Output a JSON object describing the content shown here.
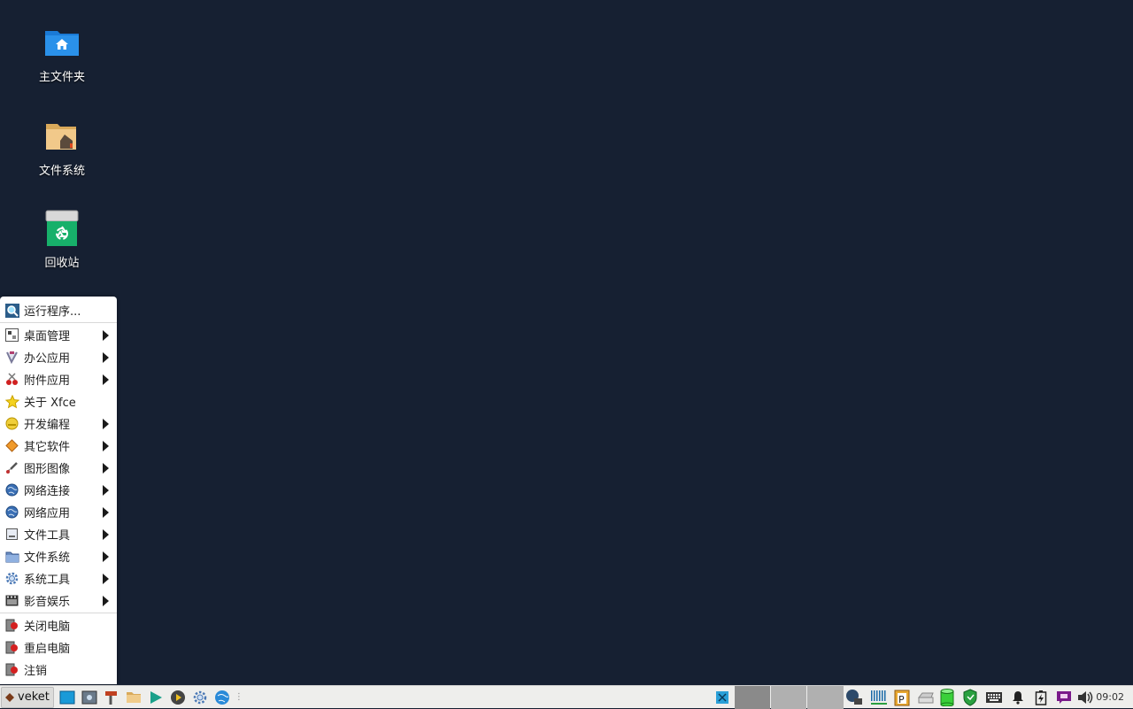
{
  "desktop": {
    "icons": [
      {
        "label": "主文件夹",
        "icon": "home-folder-icon"
      },
      {
        "label": "文件系统",
        "icon": "filesystem-folder-icon"
      },
      {
        "label": "回收站",
        "icon": "trash-icon"
      }
    ]
  },
  "menu": {
    "items": [
      {
        "label": "运行程序...",
        "icon": "search-icon",
        "submenu": false
      },
      {
        "label": "桌面管理",
        "icon": "desktop-settings-icon",
        "submenu": true
      },
      {
        "label": "办公应用",
        "icon": "office-icon",
        "submenu": true
      },
      {
        "label": "附件应用",
        "icon": "accessories-icon",
        "submenu": true
      },
      {
        "label": "关于 Xfce",
        "icon": "star-icon",
        "submenu": false
      },
      {
        "label": "开发编程",
        "icon": "development-icon",
        "submenu": true
      },
      {
        "label": "其它软件",
        "icon": "other-icon",
        "submenu": true
      },
      {
        "label": "图形图像",
        "icon": "graphics-icon",
        "submenu": true
      },
      {
        "label": "网络连接",
        "icon": "network-globe-icon",
        "submenu": true
      },
      {
        "label": "网络应用",
        "icon": "internet-globe-icon",
        "submenu": true
      },
      {
        "label": "文件工具",
        "icon": "file-tools-icon",
        "submenu": true
      },
      {
        "label": "文件系统",
        "icon": "folder-icon",
        "submenu": true
      },
      {
        "label": "系统工具",
        "icon": "gear-icon",
        "submenu": true
      },
      {
        "label": "影音娱乐",
        "icon": "multimedia-icon",
        "submenu": true
      },
      {
        "label": "关闭电脑",
        "icon": "shutdown-icon",
        "submenu": false
      },
      {
        "label": "重启电脑",
        "icon": "reboot-icon",
        "submenu": false
      },
      {
        "label": "注销",
        "icon": "logout-icon",
        "submenu": false
      }
    ]
  },
  "taskbar": {
    "start_label": "veket",
    "launchers": [
      "show-desktop-icon",
      "screenshot-icon",
      "paint-roller-icon",
      "file-manager-icon",
      "media-player-icon",
      "music-player-icon",
      "settings-gear-icon",
      "browser-icon"
    ],
    "tray": [
      "network-icon",
      "signal-meter-icon",
      "clipboard-icon",
      "printer-icon",
      "database-icon",
      "shield-icon",
      "keyboard-icon",
      "bell-icon",
      "battery-icon",
      "chat-icon",
      "volume-icon"
    ],
    "clock": "09:02"
  },
  "colors": {
    "desktop_bg": "#162032",
    "menu_bg": "#ffffff",
    "taskbar_bg": "#eeeeec"
  }
}
